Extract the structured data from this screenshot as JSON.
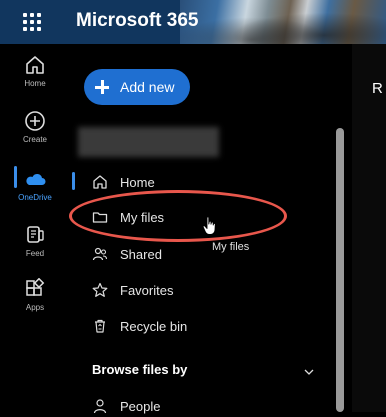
{
  "header": {
    "app_title": "Microsoft 365"
  },
  "rail": {
    "items": [
      {
        "label": "Home",
        "icon": "home-icon"
      },
      {
        "label": "Create",
        "icon": "create-icon"
      },
      {
        "label": "OneDrive",
        "icon": "onedrive-icon"
      },
      {
        "label": "Feed",
        "icon": "feed-icon"
      },
      {
        "label": "Apps",
        "icon": "apps-icon"
      }
    ]
  },
  "actions": {
    "add_new_label": "Add new"
  },
  "nav": {
    "items": [
      {
        "label": "Home",
        "icon": "home-icon"
      },
      {
        "label": "My files",
        "icon": "folder-icon"
      },
      {
        "label": "Shared",
        "icon": "shared-icon"
      },
      {
        "label": "Favorites",
        "icon": "star-icon"
      },
      {
        "label": "Recycle bin",
        "icon": "recycle-bin-icon"
      }
    ],
    "section_header": "Browse files by",
    "section_items": [
      {
        "label": "People",
        "icon": "person-icon"
      }
    ]
  },
  "main": {
    "heading_partial": "R"
  },
  "tooltip": {
    "text": "My files"
  },
  "colors": {
    "accent": "#1f6fd1",
    "highlight": "#e8574c",
    "header_bg": "#11365e"
  }
}
